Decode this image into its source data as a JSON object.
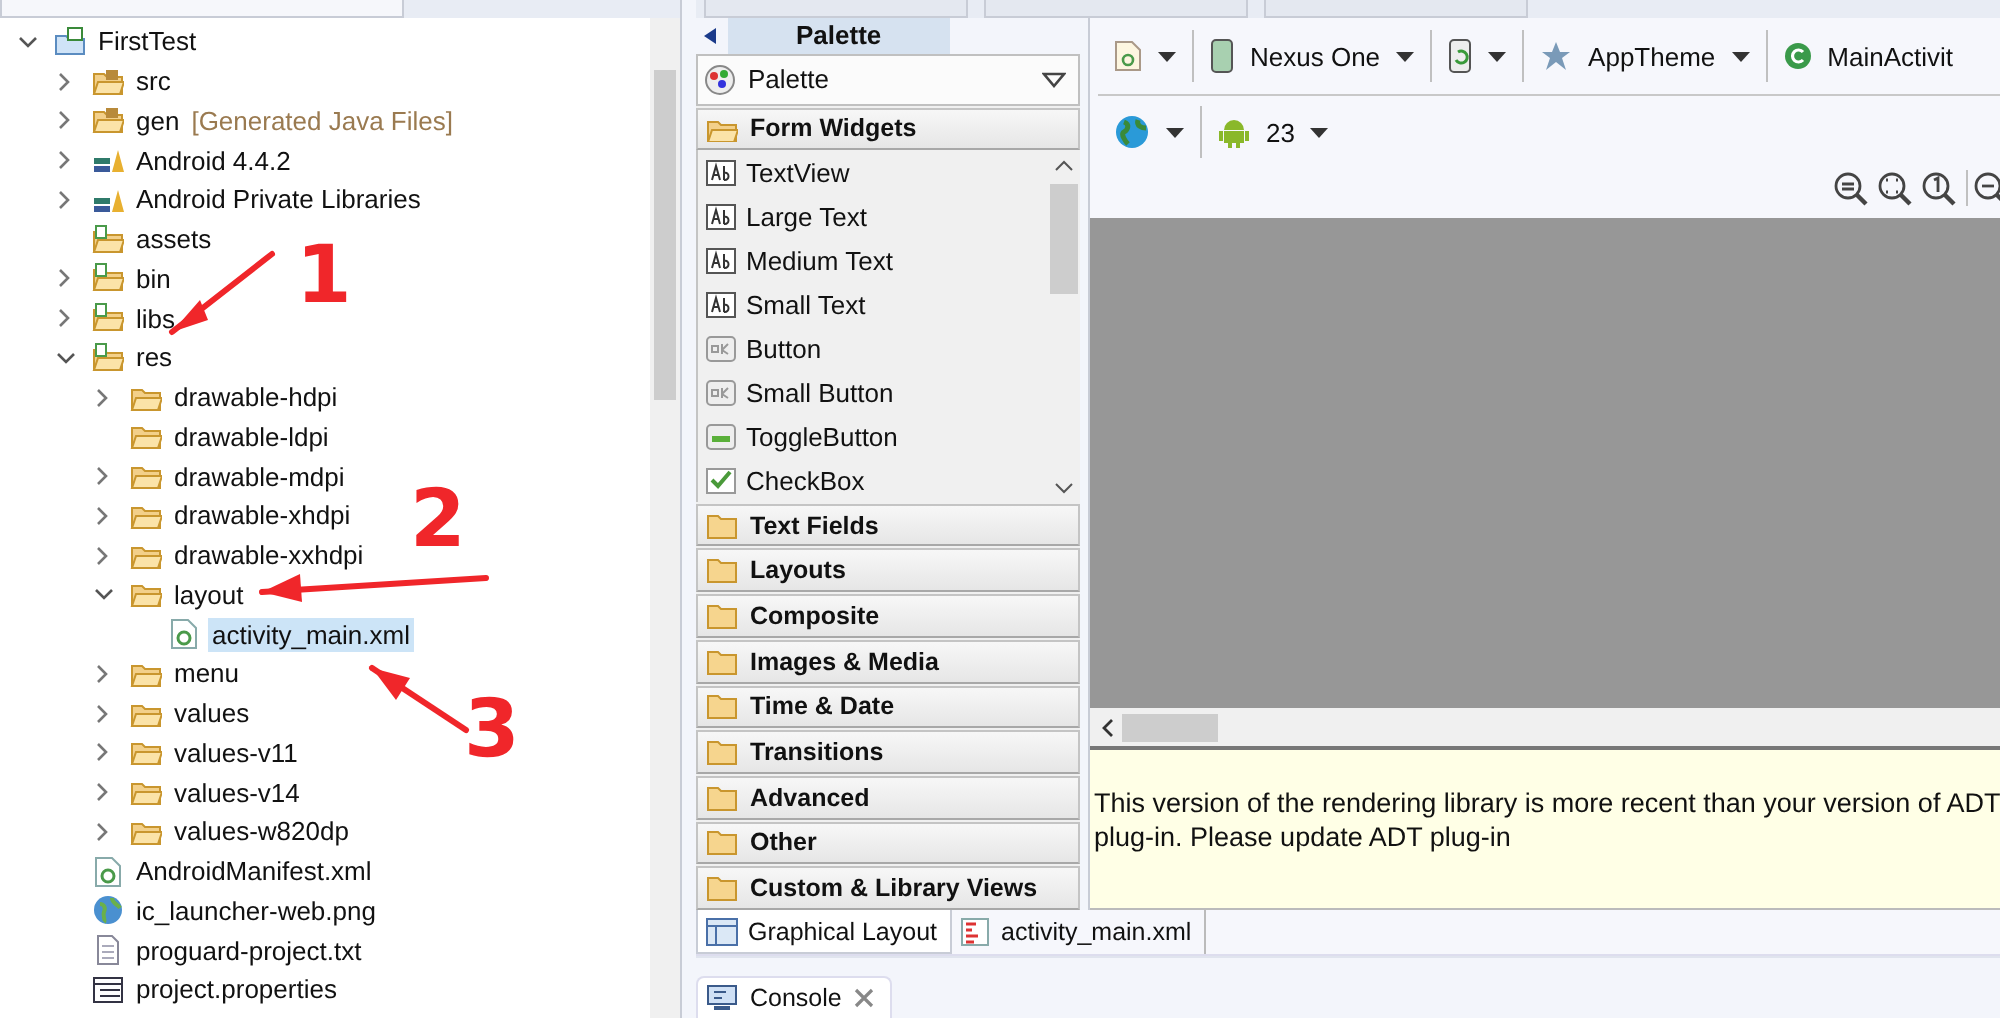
{
  "project_tree": [
    {
      "label": "FirstTest",
      "kind": "project",
      "expanded": true,
      "selected": false,
      "children": [
        {
          "label": "src",
          "kind": "package-folder",
          "expanded": false,
          "selected": false
        },
        {
          "label": "gen",
          "decoration": "[Generated Java Files]",
          "kind": "package-folder",
          "expanded": false,
          "selected": false
        },
        {
          "label": "Android 4.4.2",
          "kind": "library",
          "expanded": false,
          "selected": false
        },
        {
          "label": "Android Private Libraries",
          "kind": "library",
          "expanded": false,
          "selected": false
        },
        {
          "label": "assets",
          "kind": "source-folder",
          "selected": false
        },
        {
          "label": "bin",
          "kind": "source-folder",
          "expanded": false,
          "selected": false
        },
        {
          "label": "libs",
          "kind": "source-folder",
          "expanded": false,
          "selected": false
        },
        {
          "label": "res",
          "kind": "source-folder",
          "expanded": true,
          "selected": false,
          "children": [
            {
              "label": "drawable-hdpi",
              "kind": "folder",
              "expanded": false,
              "selected": false
            },
            {
              "label": "drawable-ldpi",
              "kind": "folder",
              "selected": false
            },
            {
              "label": "drawable-mdpi",
              "kind": "folder",
              "expanded": false,
              "selected": false
            },
            {
              "label": "drawable-xhdpi",
              "kind": "folder",
              "expanded": false,
              "selected": false
            },
            {
              "label": "drawable-xxhdpi",
              "kind": "folder",
              "expanded": false,
              "selected": false
            },
            {
              "label": "layout",
              "kind": "folder",
              "expanded": true,
              "selected": false,
              "children": [
                {
                  "label": "activity_main.xml",
                  "kind": "xml-file",
                  "selected": true
                }
              ]
            },
            {
              "label": "menu",
              "kind": "folder",
              "expanded": false,
              "selected": false
            },
            {
              "label": "values",
              "kind": "folder",
              "expanded": false,
              "selected": false
            },
            {
              "label": "values-v11",
              "kind": "folder",
              "expanded": false,
              "selected": false
            },
            {
              "label": "values-v14",
              "kind": "folder",
              "expanded": false,
              "selected": false
            },
            {
              "label": "values-w820dp",
              "kind": "folder",
              "expanded": false,
              "selected": false
            }
          ]
        },
        {
          "label": "AndroidManifest.xml",
          "kind": "xml-file",
          "selected": false
        },
        {
          "label": "ic_launcher-web.png",
          "kind": "image-file",
          "selected": false
        },
        {
          "label": "proguard-project.txt",
          "kind": "text-file",
          "selected": false
        },
        {
          "label": "project.properties",
          "kind": "properties-file",
          "selected": false
        }
      ]
    }
  ],
  "palette": {
    "title": "Palette",
    "selector": "Palette",
    "categories": [
      {
        "label": "Form Widgets",
        "expanded": true,
        "items": [
          {
            "label": "TextView",
            "kind": "text"
          },
          {
            "label": "Large Text",
            "kind": "text"
          },
          {
            "label": "Medium Text",
            "kind": "text"
          },
          {
            "label": "Small Text",
            "kind": "text"
          },
          {
            "label": "Button",
            "kind": "button"
          },
          {
            "label": "Small Button",
            "kind": "button"
          },
          {
            "label": "ToggleButton",
            "kind": "toggle"
          },
          {
            "label": "CheckBox",
            "kind": "checkbox"
          }
        ]
      },
      {
        "label": "Text Fields",
        "expanded": false
      },
      {
        "label": "Layouts",
        "expanded": false
      },
      {
        "label": "Composite",
        "expanded": false
      },
      {
        "label": "Images & Media",
        "expanded": false
      },
      {
        "label": "Time & Date",
        "expanded": false
      },
      {
        "label": "Transitions",
        "expanded": false
      },
      {
        "label": "Advanced",
        "expanded": false
      },
      {
        "label": "Other",
        "expanded": false
      },
      {
        "label": "Custom & Library Views",
        "expanded": false
      }
    ]
  },
  "editor_toolbar": {
    "row_1": [
      {
        "kind": "file"
      },
      {
        "kind": "device",
        "label": "Nexus One"
      },
      {
        "kind": "rotate"
      },
      {
        "kind": "theme",
        "label": "AppTheme"
      },
      {
        "kind": "activity",
        "label": "MainActivit"
      }
    ],
    "row_2": [
      {
        "kind": "locale"
      },
      {
        "kind": "api",
        "label": "23"
      }
    ]
  },
  "message": "This version of the rendering library is more recent than your version of ADT plug-in. Please update ADT plug-in",
  "editor_tabs": [
    {
      "label": "Graphical Layout",
      "selected": true
    },
    {
      "label": "activity_main.xml",
      "selected": false
    }
  ],
  "bottom_tabs": [
    {
      "label": "Console",
      "selected": true
    }
  ],
  "annotations": [
    {
      "label": "1"
    },
    {
      "label": "2"
    },
    {
      "label": "3"
    }
  ]
}
